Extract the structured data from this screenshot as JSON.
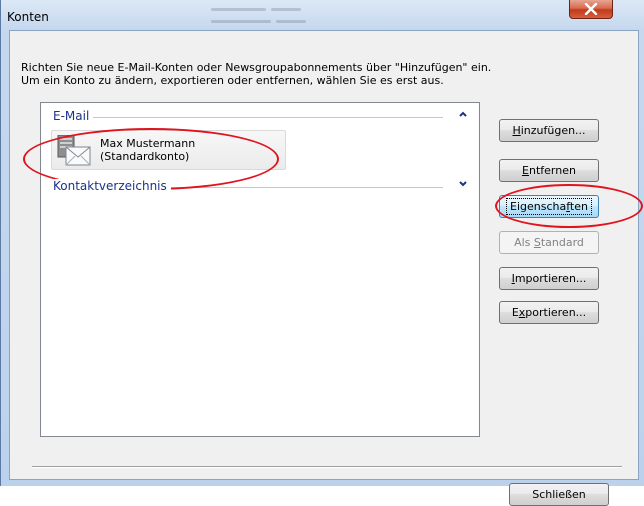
{
  "window": {
    "title": "Konten",
    "close_glyph": "X"
  },
  "description": {
    "line1": "Richten Sie neue E-Mail-Konten oder Newsgroupabonnements über \"Hinzufügen\" ein.",
    "line2": "Um ein Konto zu ändern, exportieren oder entfernen, wählen Sie es erst aus."
  },
  "list": {
    "groups": [
      {
        "label": "E-Mail",
        "chevron": "chevron-up-icon"
      },
      {
        "label": "Kontaktverzeichnis",
        "chevron": "chevron-down-icon"
      }
    ],
    "account": {
      "name": "Max Mustermann",
      "note": "(Standardkonto)",
      "icon": "mail-server-icon"
    }
  },
  "buttons": {
    "add": {
      "pre": "",
      "key": "H",
      "post": "inzufügen..."
    },
    "remove": {
      "pre": "",
      "key": "E",
      "post": "ntfernen"
    },
    "properties": {
      "pre": "Eigenscha",
      "key": "f",
      "post": "ten"
    },
    "set_default": {
      "pre": "Als ",
      "key": "S",
      "post": "tandard"
    },
    "import": {
      "pre": "",
      "key": "I",
      "post": "mportieren..."
    },
    "export": {
      "pre": "E",
      "key": "x",
      "post": "portieren..."
    },
    "close": {
      "pre": "Schließen",
      "key": "",
      "post": ""
    }
  },
  "colors": {
    "annotation": "#e0141e",
    "group_header": "#1e3287",
    "close_button": "#c33a1c"
  }
}
